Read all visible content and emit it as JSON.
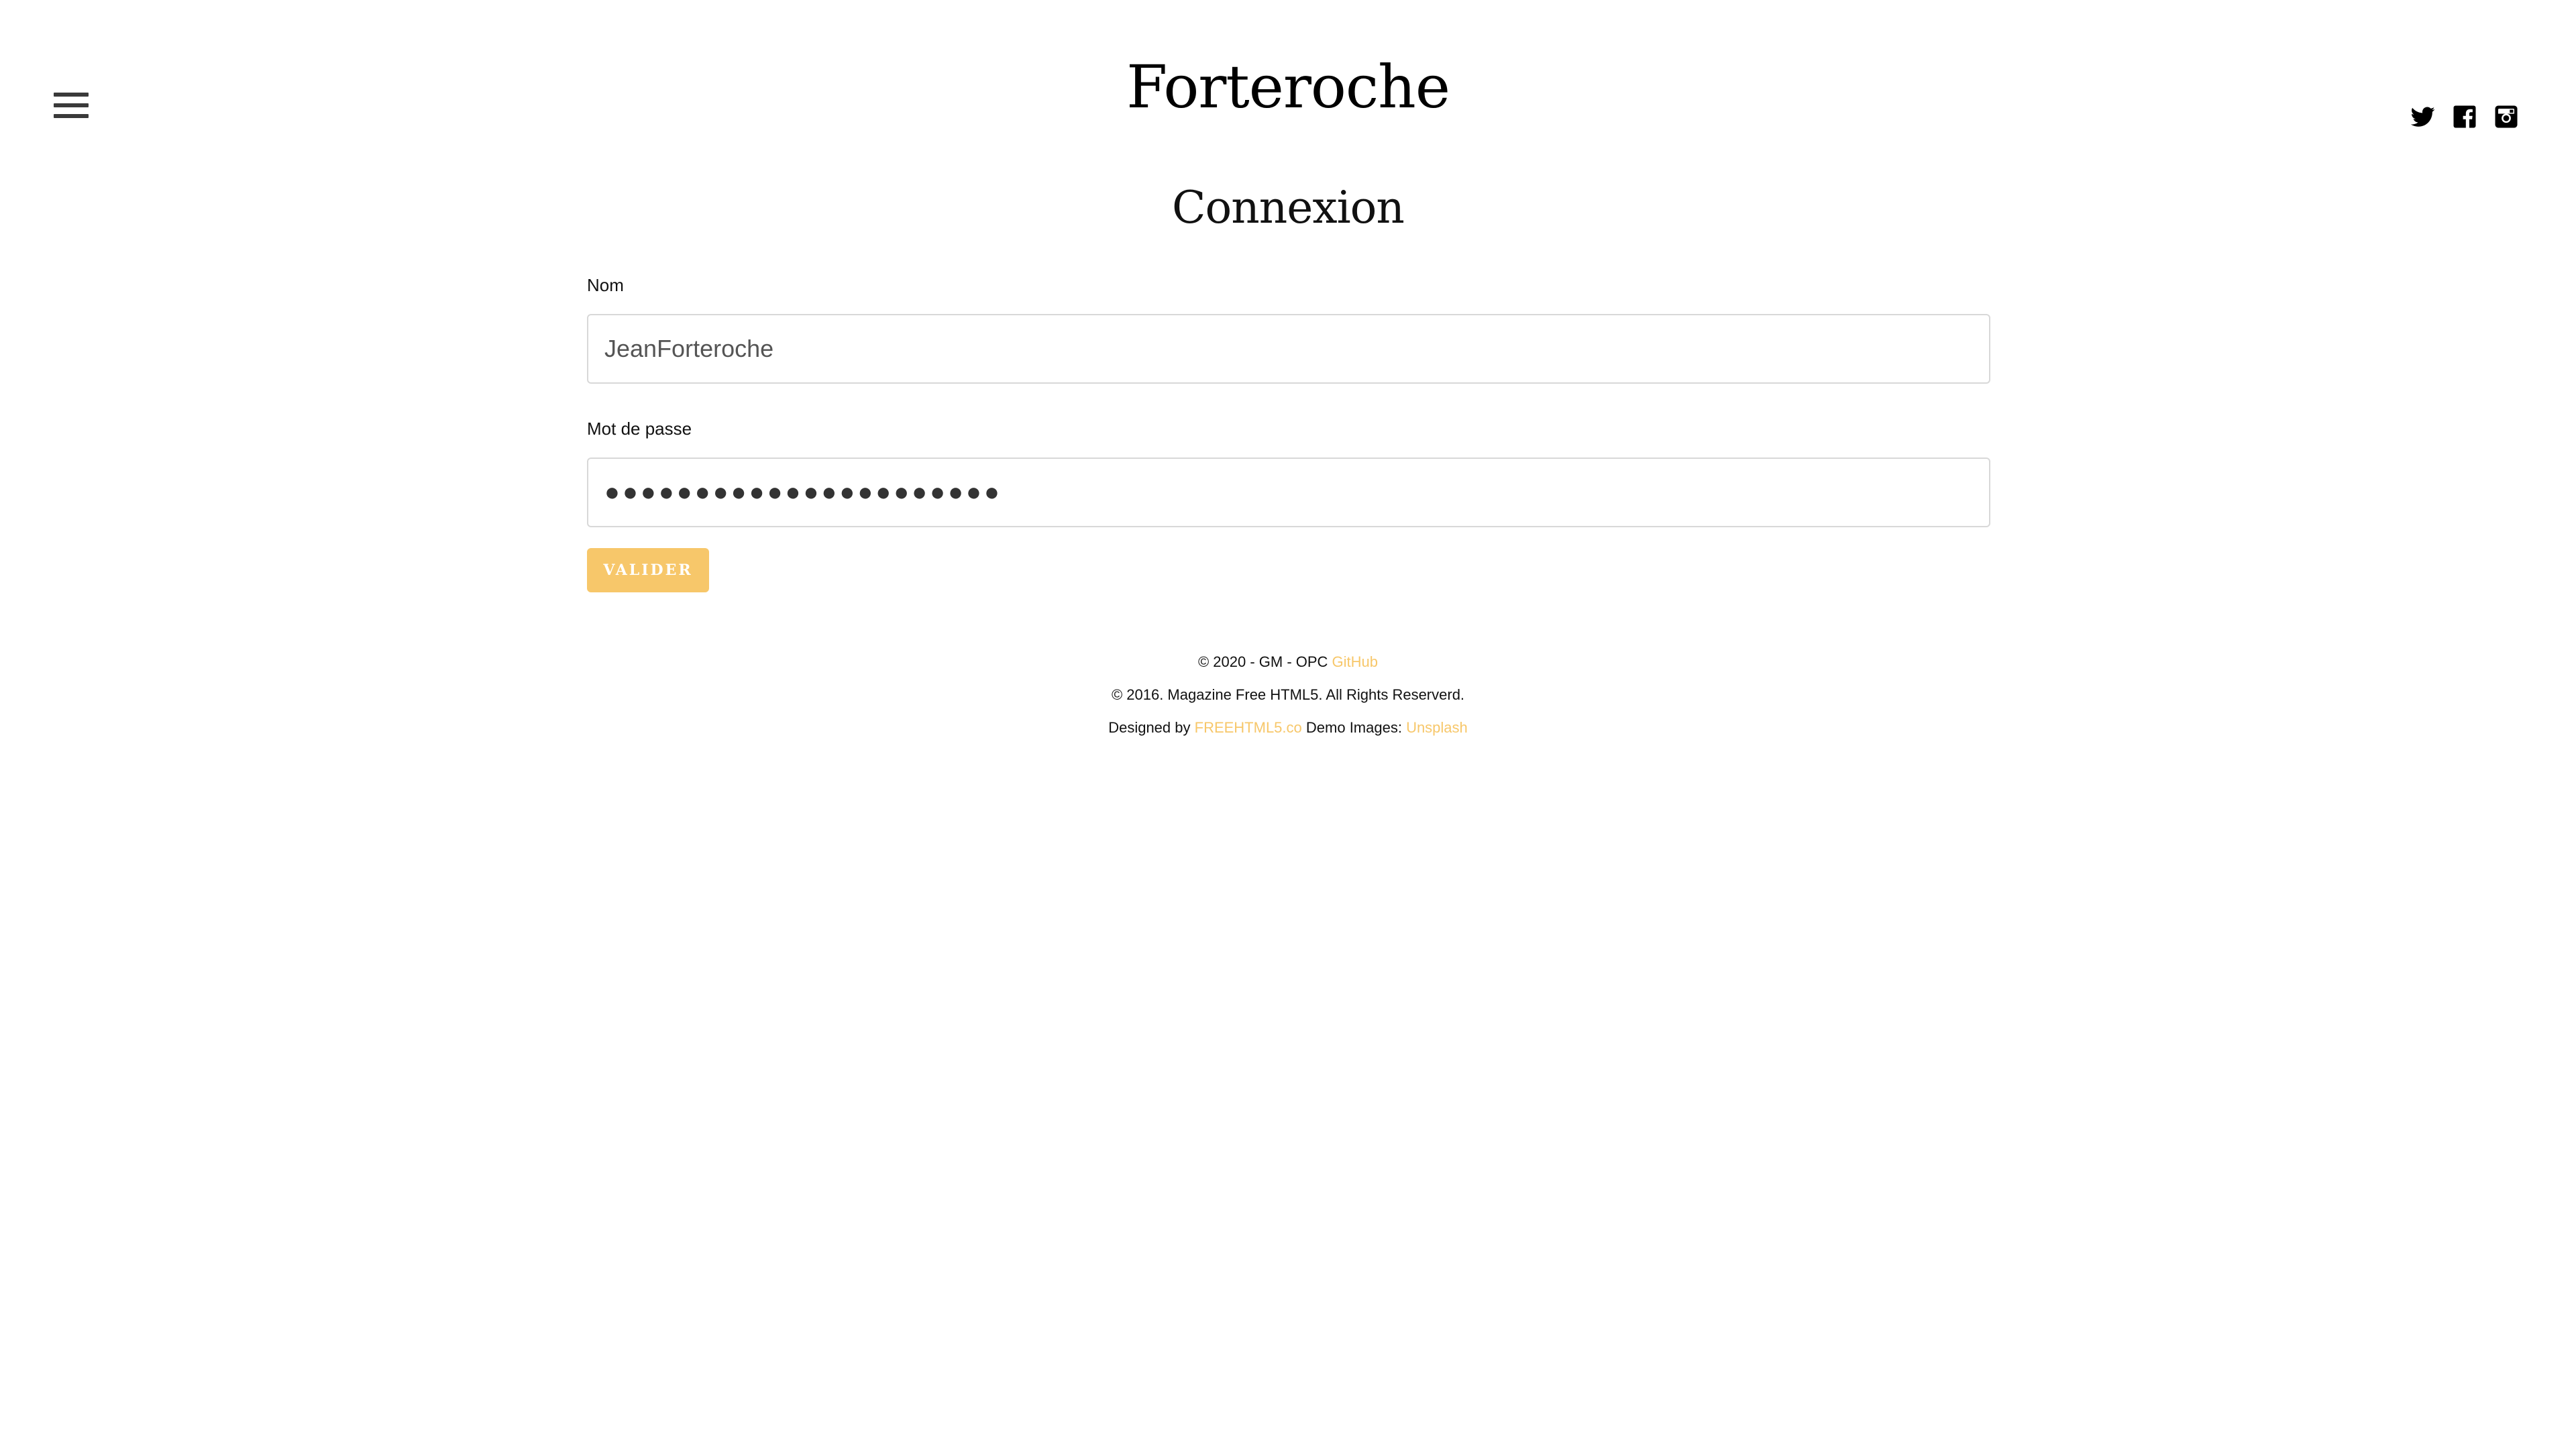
{
  "header": {
    "menu_icon": "hamburger-menu-icon",
    "site_title": "Forteroche",
    "social": [
      {
        "name": "twitter",
        "icon": "twitter-icon"
      },
      {
        "name": "facebook",
        "icon": "facebook-icon"
      },
      {
        "name": "instagram",
        "icon": "instagram-icon"
      }
    ]
  },
  "main": {
    "heading": "Connexion",
    "form": {
      "name_label": "Nom",
      "name_value": "JeanForteroche",
      "password_label": "Mot de passe",
      "password_value": "●●●●●●●●●●●●●●●●●●●●●●",
      "submit_label": "VALIDER"
    }
  },
  "footer": {
    "line1_text": "© 2020 - GM - OPC ",
    "line1_link": "GitHub",
    "line2_text": "© 2016. Magazine Free HTML5. All Rights Reserverd.",
    "line3_prefix": "Designed by ",
    "line3_link1": "FREEHTML5.co",
    "line3_middle": " Demo Images: ",
    "line3_link2": "Unsplash"
  },
  "colors": {
    "accent": "#f7c76a",
    "text": "#111111",
    "input_border": "#d8d8d8",
    "background": "#ffffff"
  }
}
